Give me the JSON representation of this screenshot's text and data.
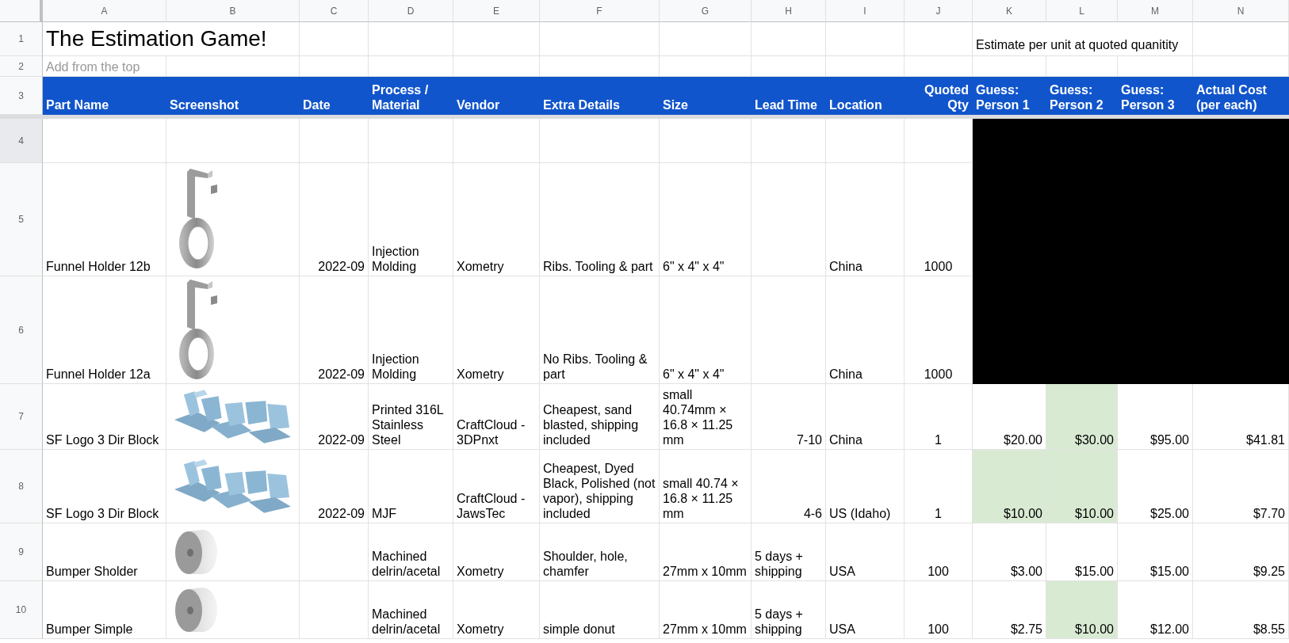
{
  "column_headers": [
    "A",
    "B",
    "C",
    "D",
    "E",
    "F",
    "G",
    "H",
    "I",
    "J",
    "K",
    "L",
    "M",
    "N"
  ],
  "title": "The Estimation Game!",
  "note": "Estimate per unit at quoted quanitity",
  "subtitle": "Add from the top",
  "row_numbers": [
    "1",
    "2",
    "3"
  ],
  "headers": [
    "Part Name",
    "Screenshot",
    "Date",
    "Process / Material",
    "Vendor",
    "Extra Details",
    "Size",
    "Lead Time",
    "Location",
    "Quoted Qty",
    "Guess: Person 1",
    "Guess: Person 2",
    "Guess: Person 3",
    "Actual Cost (per each)"
  ],
  "rows": [
    {
      "number": "4",
      "redacted": true
    },
    {
      "number": "5",
      "redacted": true,
      "part_name": "Funnel Holder 12b",
      "kind": "hook",
      "date": "2022-09",
      "process": "Injection Molding",
      "vendor": "Xometry",
      "details": "Ribs. Tooling & part",
      "size": "6\" x  4\" x 4\"",
      "location": "China",
      "qty": "1000"
    },
    {
      "number": "6",
      "redacted": true,
      "part_name": "Funnel Holder 12a",
      "kind": "hook",
      "date": "2022-09",
      "process": "Injection Molding",
      "vendor": "Xometry",
      "details": "No Ribs. Tooling & part",
      "size": "6\" x  4\" x 4\"",
      "location": "China",
      "qty": "1000"
    },
    {
      "number": "7",
      "redacted": false,
      "part_name": "SF Logo 3 Dir Block",
      "kind": "logo",
      "date": "2022-09",
      "process": "Printed 316L Stainless Steel",
      "vendor": "CraftCloud - 3DPnxt",
      "details": "Cheapest, sand blasted, shipping included",
      "size": "small 40.74mm × 16.8 × 11.25 mm",
      "lead_time": "7-10",
      "location": "China",
      "qty": "1",
      "guesses": [
        {
          "value": "$20.00",
          "highlighted": false
        },
        {
          "value": "$30.00",
          "highlighted": true
        },
        {
          "value": "$95.00",
          "highlighted": false
        }
      ],
      "actual": "$41.81"
    },
    {
      "number": "8",
      "redacted": false,
      "part_name": "SF Logo 3 Dir Block",
      "kind": "logo",
      "date": "2022-09",
      "process": "MJF",
      "vendor": "CraftCloud - JawsTec",
      "details": "Cheapest, Dyed Black, Polished (not vapor), shipping included",
      "size": "small 40.74 × 16.8 × 11.25 mm",
      "lead_time": "4-6",
      "location": "US (Idaho)",
      "qty": "1",
      "guesses": [
        {
          "value": "$10.00",
          "highlighted": true
        },
        {
          "value": "$10.00",
          "highlighted": true
        },
        {
          "value": "$25.00",
          "highlighted": false
        }
      ],
      "actual": "$7.70"
    },
    {
      "number": "9",
      "redacted": false,
      "part_name": "Bumper Sholder",
      "kind": "disc",
      "process": "Machined delrin/acetal",
      "vendor": "Xometry",
      "details": "Shoulder, hole, chamfer",
      "size": "27mm x 10mm",
      "lead_time": "5 days + shipping",
      "location": "USA",
      "qty": "100",
      "guesses": [
        {
          "value": "$3.00",
          "highlighted": false
        },
        {
          "value": "$15.00",
          "highlighted": false
        },
        {
          "value": "$15.00",
          "highlighted": false
        }
      ],
      "actual": "$9.25"
    },
    {
      "number": "10",
      "redacted": false,
      "part_name": "Bumper Simple",
      "kind": "disc",
      "process": "Machined delrin/acetal",
      "vendor": "Xometry",
      "details": "simple donut",
      "size": "27mm x 10mm",
      "lead_time": "5 days + shipping",
      "location": "USA",
      "qty": "100",
      "guesses": [
        {
          "value": "$2.75",
          "highlighted": false
        },
        {
          "value": "$10.00",
          "highlighted": true
        },
        {
          "value": "$12.00",
          "highlighted": false
        }
      ],
      "actual": "$8.55"
    }
  ]
}
